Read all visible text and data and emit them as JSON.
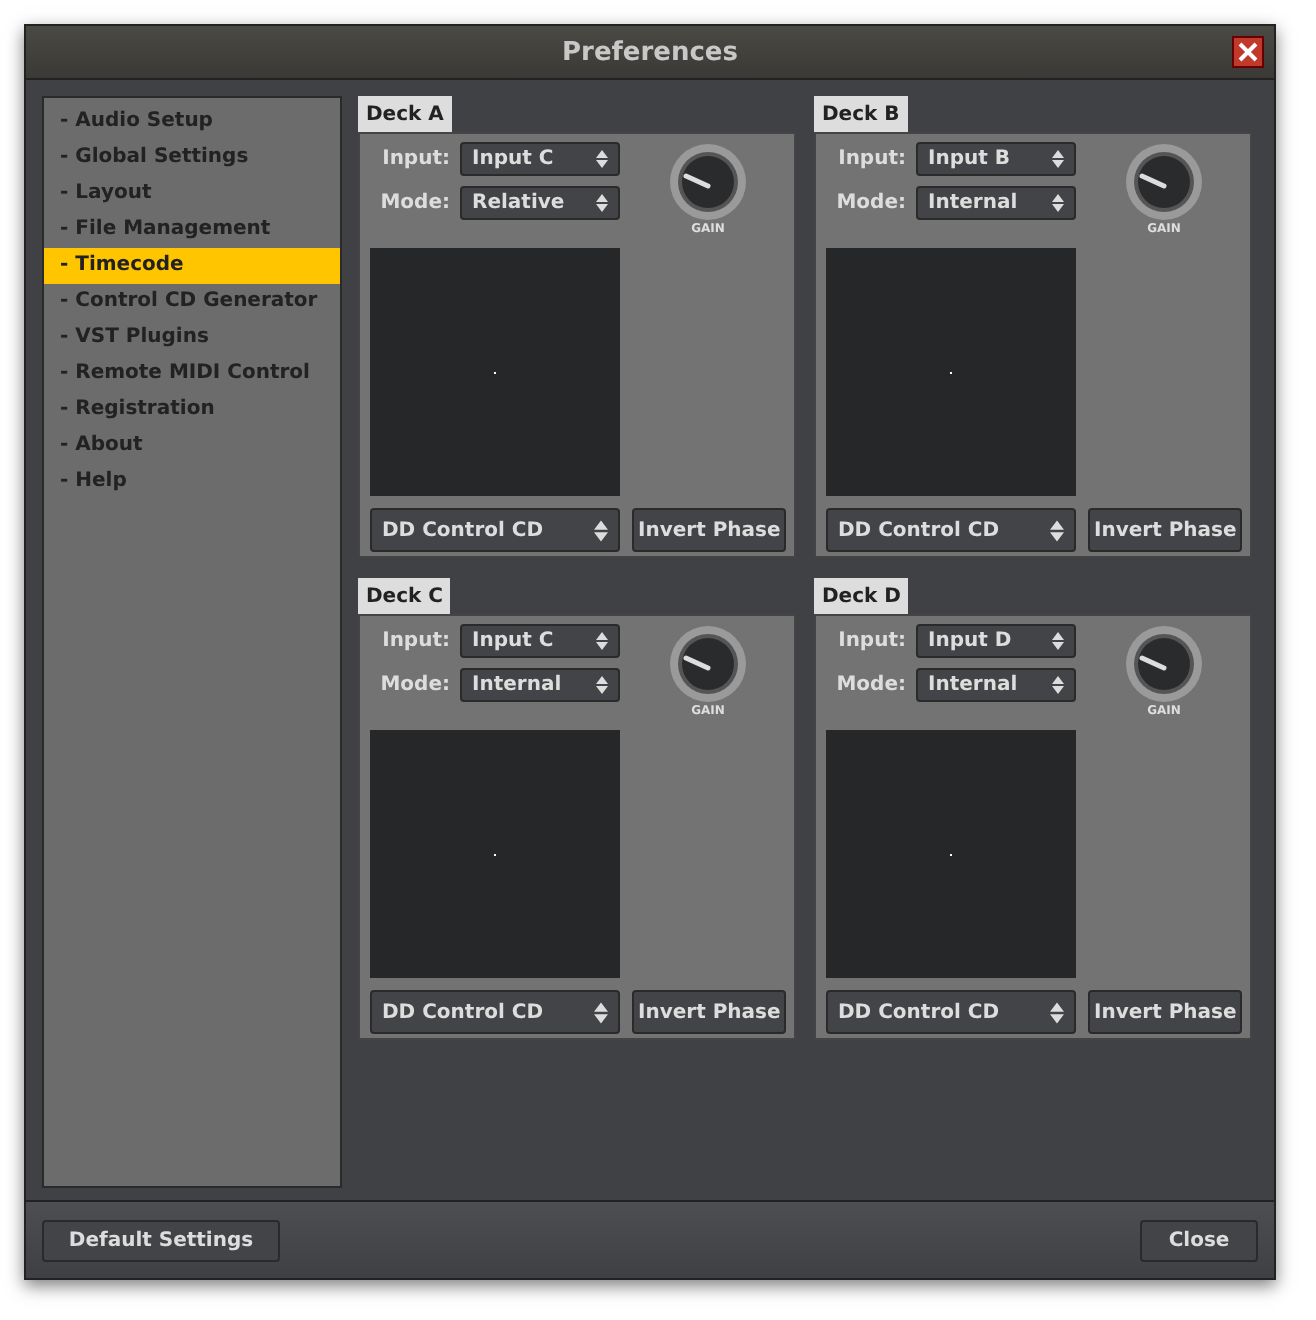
{
  "window": {
    "title": "Preferences"
  },
  "sidebar": {
    "items": [
      {
        "label": "- Audio Setup",
        "selected": false
      },
      {
        "label": "- Global Settings",
        "selected": false
      },
      {
        "label": "- Layout",
        "selected": false
      },
      {
        "label": "- File Management",
        "selected": false
      },
      {
        "label": "- Timecode",
        "selected": true
      },
      {
        "label": "- Control CD Generator",
        "selected": false
      },
      {
        "label": "- VST Plugins",
        "selected": false
      },
      {
        "label": "- Remote MIDI Control",
        "selected": false
      },
      {
        "label": "- Registration",
        "selected": false
      },
      {
        "label": "- About",
        "selected": false
      },
      {
        "label": "- Help",
        "selected": false
      }
    ]
  },
  "decks": [
    {
      "title": "Deck A",
      "input_label": "Input:",
      "input": "Input C",
      "mode_label": "Mode:",
      "mode": "Relative",
      "knob_label": "GAIN",
      "control": "DD Control CD",
      "invert_button": "Invert Phase"
    },
    {
      "title": "Deck B",
      "input_label": "Input:",
      "input": "Input B",
      "mode_label": "Mode:",
      "mode": "Internal",
      "knob_label": "GAIN",
      "control": "DD Control CD",
      "invert_button": "Invert Phase"
    },
    {
      "title": "Deck C",
      "input_label": "Input:",
      "input": "Input C",
      "mode_label": "Mode:",
      "mode": "Internal",
      "knob_label": "GAIN",
      "control": "DD Control CD",
      "invert_button": "Invert Phase"
    },
    {
      "title": "Deck D",
      "input_label": "Input:",
      "input": "Input D",
      "mode_label": "Mode:",
      "mode": "Internal",
      "knob_label": "GAIN",
      "control": "DD Control CD",
      "invert_button": "Invert Phase"
    }
  ],
  "footer": {
    "left_button": "Default Settings",
    "right_button": "Close"
  }
}
